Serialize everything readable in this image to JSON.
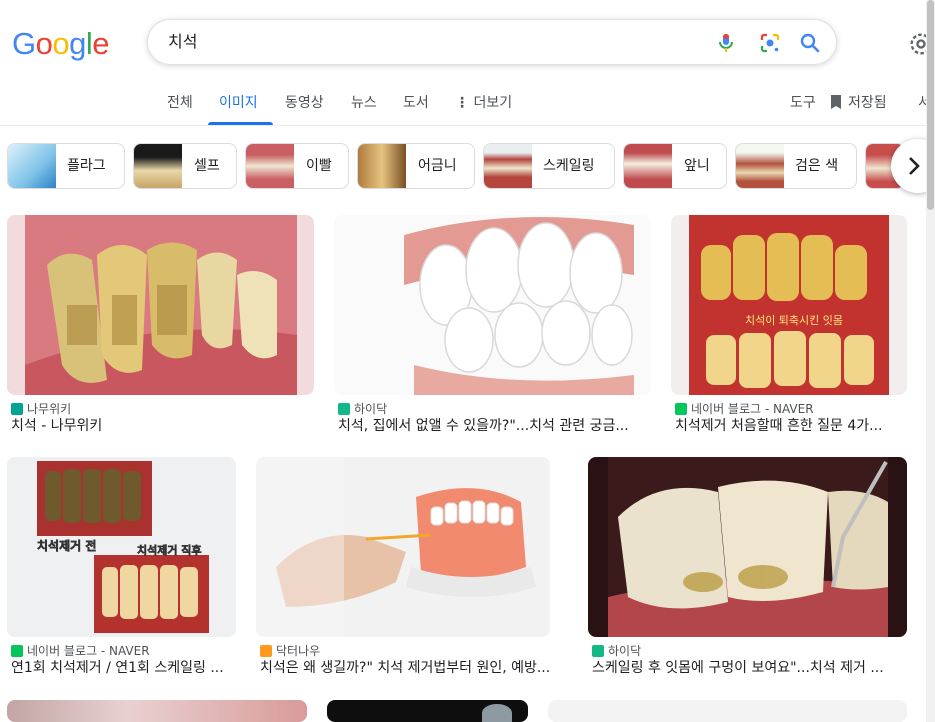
{
  "logo": "Google",
  "search": {
    "query": "치석"
  },
  "tabs": [
    {
      "label": "전체",
      "active": false
    },
    {
      "label": "이미지",
      "active": true
    },
    {
      "label": "동영상",
      "active": false
    },
    {
      "label": "뉴스",
      "active": false
    },
    {
      "label": "도서",
      "active": false
    },
    {
      "label": "더보기",
      "active": false
    }
  ],
  "tools": {
    "label": "도구",
    "saved": "저장됨",
    "more_cut": "서"
  },
  "chips": [
    "플라그",
    "셀프",
    "이빨",
    "어금니",
    "스케일링",
    "앞니",
    "검은 색"
  ],
  "results": [
    {
      "source": "나무위키",
      "title": "치석 - 나무위키",
      "fav_color": "#00a495"
    },
    {
      "source": "하이닥",
      "title": "치석, 집에서 없앨 수 있을까?\"...치석 관련 궁금...",
      "fav_color": "#12b886"
    },
    {
      "source": "네이버 블로그 - NAVER",
      "title": "치석제거 처음할때 흔한 질문 4가...",
      "fav_color": "#03c75a"
    },
    {
      "source": "네이버 블로그 - NAVER",
      "title": "연1회 치석제거 / 연1회 스케일링 ...",
      "fav_color": "#03c75a",
      "overlay1": "치석제거 전",
      "overlay2": "치석제거 직후"
    },
    {
      "source": "닥터나우",
      "title": "치석은 왜 생길까?\" 치석 제거법부터 원인, 예방...",
      "fav_color": "#ff9a1f"
    },
    {
      "source": "하이닥",
      "title": "스케일링 후 잇몸에 구멍이 보여요\"...치석 제거 ...",
      "fav_color": "#12b886"
    }
  ],
  "colors": {
    "accent": "#1a73e8",
    "border": "#dadce0"
  }
}
